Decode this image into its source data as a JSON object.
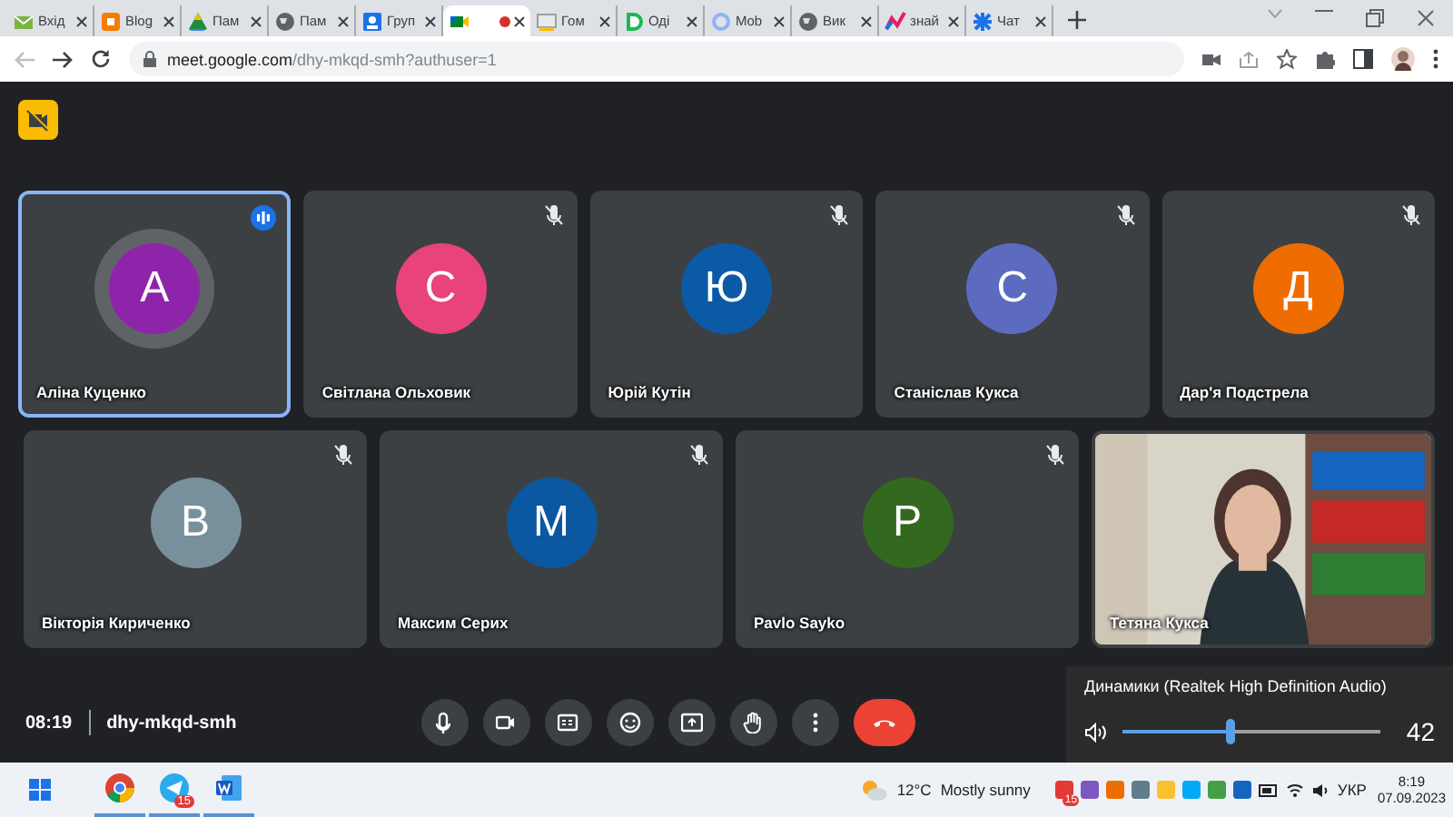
{
  "browser": {
    "tabs": [
      {
        "kind": "mail",
        "title": "Вхід",
        "selected": false
      },
      {
        "kind": "blogger",
        "title": "Blog",
        "selected": false
      },
      {
        "kind": "drive",
        "title": "Пам",
        "selected": false
      },
      {
        "kind": "globe",
        "title": "Пам",
        "selected": false
      },
      {
        "kind": "contacts",
        "title": "Груп",
        "selected": false
      },
      {
        "kind": "meet",
        "selected": true,
        "recording": true
      },
      {
        "kind": "slides",
        "title": "Гом",
        "selected": false
      },
      {
        "kind": "doc",
        "title": "Оді",
        "selected": false
      },
      {
        "kind": "mob",
        "title": "Mob",
        "selected": false
      },
      {
        "kind": "globe",
        "title": "Вик",
        "selected": false
      },
      {
        "kind": "chart",
        "title": "знай",
        "selected": false
      },
      {
        "kind": "chat",
        "title": "Чат",
        "selected": false
      }
    ],
    "url": "meet.google.com/dhy-mkqd-smh?authuser=1"
  },
  "participants": [
    {
      "kind": "avatar",
      "name": "Аліна Куценко",
      "initial": "А",
      "color": "#8e24aa",
      "muted": false,
      "speaking": true
    },
    {
      "kind": "avatar",
      "name": "Світлана Ольховик",
      "initial": "С",
      "color": "#e8437a",
      "muted": true,
      "speaking": false
    },
    {
      "kind": "avatar",
      "name": "Юрій Кутін",
      "initial": "Ю",
      "color": "#0b5aa6",
      "muted": true,
      "speaking": false
    },
    {
      "kind": "avatar",
      "name": "Станіслав Кукса",
      "initial": "С",
      "color": "#5c6bc0",
      "muted": true,
      "speaking": false
    },
    {
      "kind": "avatar",
      "name": "Дар'я Подстрела",
      "initial": "Д",
      "color": "#ef6c00",
      "muted": true,
      "speaking": false
    },
    {
      "kind": "avatar",
      "name": "Вікторія Кириченко",
      "initial": "В",
      "color": "#78909c",
      "muted": true,
      "speaking": false
    },
    {
      "kind": "avatar",
      "name": "Максим Серих",
      "initial": "М",
      "color": "#0b57a0",
      "muted": true,
      "speaking": false
    },
    {
      "kind": "avatar",
      "name": "Pavlo Sayko",
      "initial": "P",
      "color": "#33691e",
      "muted": true,
      "speaking": false
    },
    {
      "kind": "video",
      "name": "Тетяна Кукса"
    }
  ],
  "meeting": {
    "time": "08:19",
    "code": "dhy-mkqd-smh"
  },
  "controls": [
    {
      "kind": "mic"
    },
    {
      "kind": "camera"
    },
    {
      "kind": "captions"
    },
    {
      "kind": "emoji"
    },
    {
      "kind": "present"
    },
    {
      "kind": "hand"
    },
    {
      "kind": "more"
    },
    {
      "kind": "hangup"
    }
  ],
  "volume": {
    "device": "Динамики (Realtek High Definition Audio)",
    "level": 0.42,
    "reading": "42"
  },
  "taskbar": {
    "app_badge": "15",
    "temperature": "12°C",
    "weather": "Mostly sunny",
    "tray_badge": "15",
    "language": "УКР",
    "time": "8:19",
    "date": "07.09.2023"
  }
}
